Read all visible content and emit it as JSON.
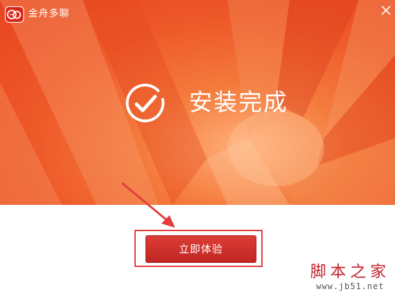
{
  "window": {
    "title": "金舟多聊",
    "close_icon": "close-icon",
    "logo_icon": "app-logo-icon"
  },
  "main": {
    "status_title": "安装完成",
    "status_icon": "check-circle-icon",
    "start_button_label": "立即体验"
  },
  "watermark": {
    "brand": "脚本之家",
    "url": "www.jb51.net"
  },
  "colors": {
    "banner_orange": "#ee5a2a",
    "button_red": "#c9302a",
    "highlight_red": "#e23c3c",
    "watermark_red": "#c3242d"
  }
}
